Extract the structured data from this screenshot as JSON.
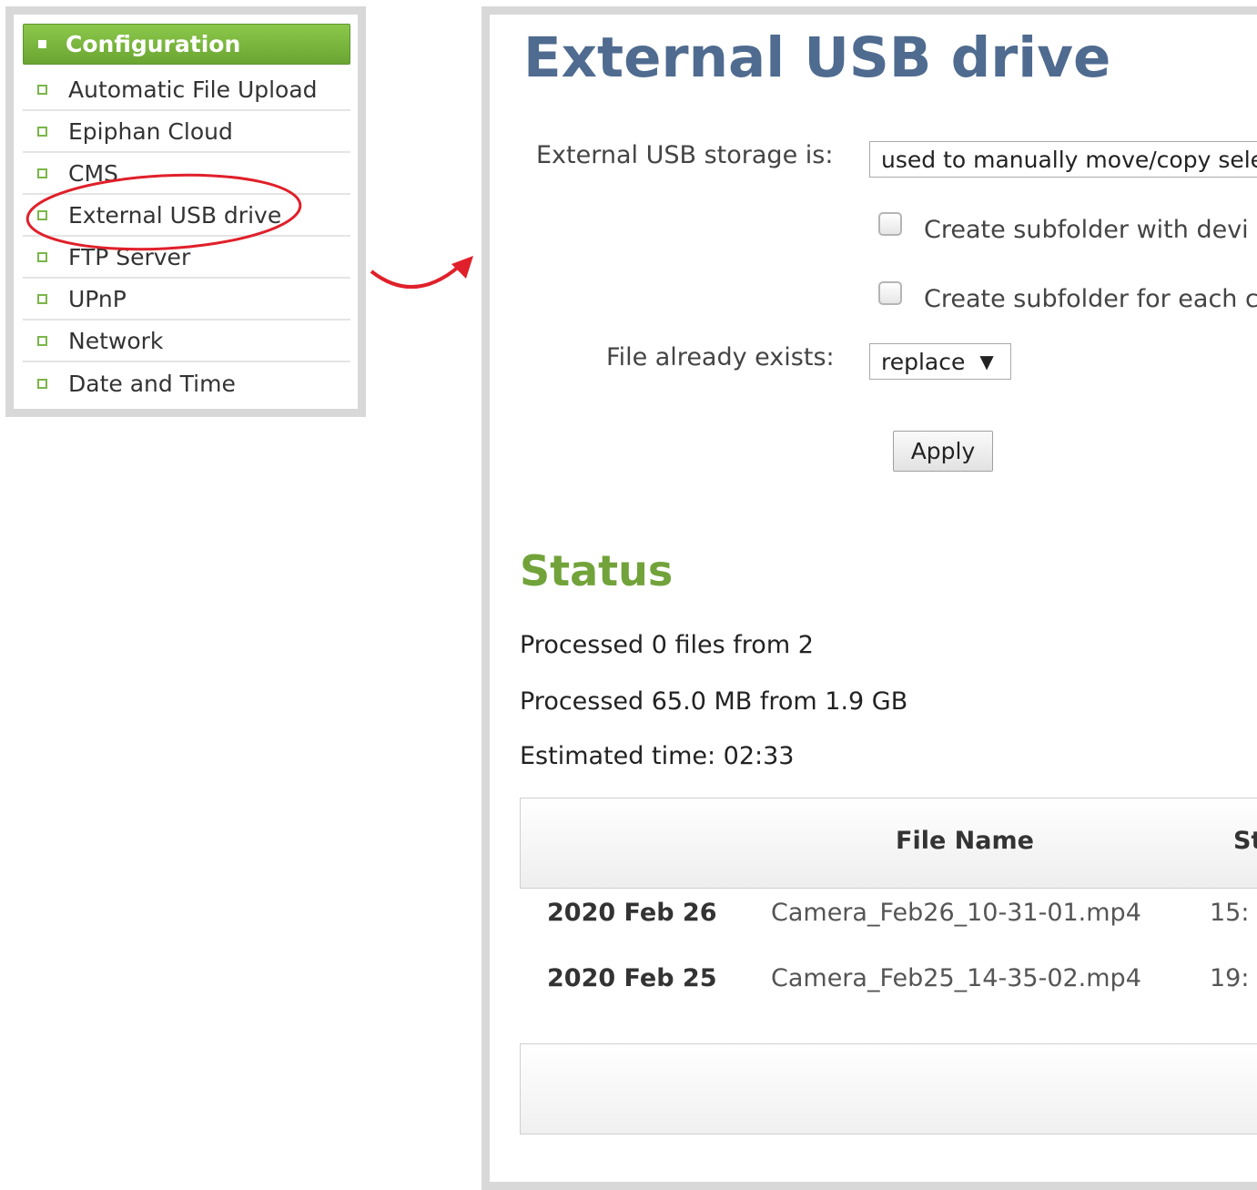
{
  "sidebar": {
    "header": "Configuration",
    "items": [
      {
        "label": "Automatic File Upload"
      },
      {
        "label": "Epiphan Cloud"
      },
      {
        "label": "CMS"
      },
      {
        "label": "External USB drive",
        "highlighted": true
      },
      {
        "label": "FTP Server"
      },
      {
        "label": "UPnP"
      },
      {
        "label": "Network"
      },
      {
        "label": "Date and Time"
      }
    ]
  },
  "main": {
    "title": "External USB drive",
    "storage_label": "External USB storage is:",
    "storage_value": "used to manually move/copy sele",
    "checkbox1_label": "Create subfolder with devi",
    "checkbox1_checked": false,
    "checkbox2_label": "Create subfolder for each c",
    "checkbox2_checked": false,
    "exists_label": "File already exists:",
    "exists_value": "replace",
    "apply_label": "Apply"
  },
  "status": {
    "title": "Status",
    "files_line": "Processed 0 files from 2",
    "size_line": "Processed 65.0 MB from 1.9 GB",
    "time_line": "Estimated time: 02:33",
    "table": {
      "headers": {
        "file_name": "File Name",
        "third": "St"
      },
      "rows": [
        {
          "date": "2020 Feb 26",
          "file": "Camera_Feb26_10-31-01.mp4",
          "time": "15:"
        },
        {
          "date": "2020 Feb 25",
          "file": "Camera_Feb25_14-35-02.mp4",
          "time": "19:"
        }
      ]
    }
  },
  "colors": {
    "title_blue": "#4f6b8f",
    "status_green": "#72a33b",
    "nav_green": "#7ab648",
    "annotation_red": "#e0202a"
  }
}
